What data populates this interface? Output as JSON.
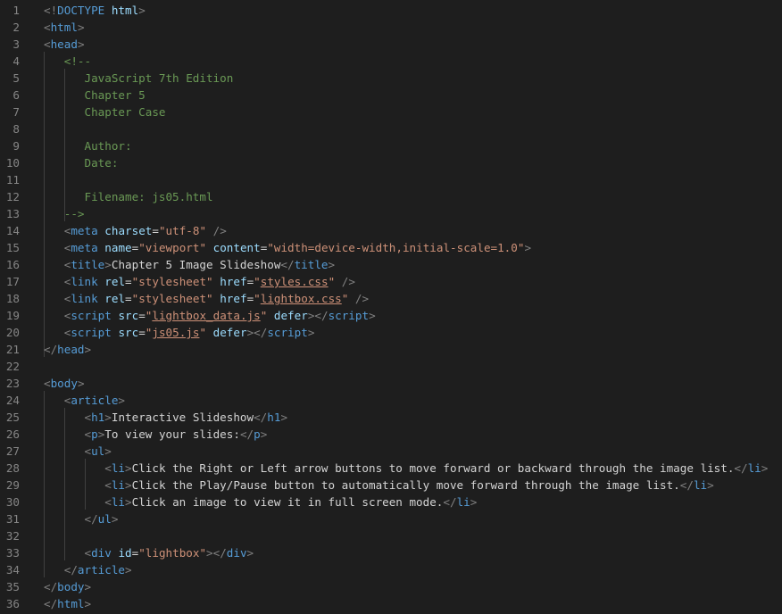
{
  "editor": {
    "lines": [
      [
        {
          "t": "<!",
          "c": "br"
        },
        {
          "t": "DOCTYPE",
          "c": "tag"
        },
        {
          "t": " ",
          "c": "txt"
        },
        {
          "t": "html",
          "c": "attr"
        },
        {
          "t": ">",
          "c": "br"
        }
      ],
      [
        {
          "t": "<",
          "c": "br"
        },
        {
          "t": "html",
          "c": "tag"
        },
        {
          "t": ">",
          "c": "br"
        }
      ],
      [
        {
          "t": "<",
          "c": "br"
        },
        {
          "t": "head",
          "c": "tag"
        },
        {
          "t": ">",
          "c": "br"
        }
      ],
      [
        {
          "t": "   ",
          "c": "txt"
        },
        {
          "t": "<!--",
          "c": "cmt"
        }
      ],
      [
        {
          "t": "      JavaScript 7th Edition",
          "c": "cmt"
        }
      ],
      [
        {
          "t": "      Chapter 5",
          "c": "cmt"
        }
      ],
      [
        {
          "t": "      Chapter Case",
          "c": "cmt"
        }
      ],
      [],
      [
        {
          "t": "      Author:",
          "c": "cmt"
        }
      ],
      [
        {
          "t": "      Date:",
          "c": "cmt"
        }
      ],
      [],
      [
        {
          "t": "      Filename: js05.html",
          "c": "cmt"
        }
      ],
      [
        {
          "t": "   -->",
          "c": "cmt"
        }
      ],
      [
        {
          "t": "   ",
          "c": "txt"
        },
        {
          "t": "<",
          "c": "br"
        },
        {
          "t": "meta",
          "c": "tag"
        },
        {
          "t": " ",
          "c": "txt"
        },
        {
          "t": "charset",
          "c": "attr"
        },
        {
          "t": "=",
          "c": "txt"
        },
        {
          "t": "\"utf-8\"",
          "c": "str"
        },
        {
          "t": " />",
          "c": "br"
        }
      ],
      [
        {
          "t": "   ",
          "c": "txt"
        },
        {
          "t": "<",
          "c": "br"
        },
        {
          "t": "meta",
          "c": "tag"
        },
        {
          "t": " ",
          "c": "txt"
        },
        {
          "t": "name",
          "c": "attr"
        },
        {
          "t": "=",
          "c": "txt"
        },
        {
          "t": "\"viewport\"",
          "c": "str"
        },
        {
          "t": " ",
          "c": "txt"
        },
        {
          "t": "content",
          "c": "attr"
        },
        {
          "t": "=",
          "c": "txt"
        },
        {
          "t": "\"width=device-width,initial-scale=1.0\"",
          "c": "str"
        },
        {
          "t": ">",
          "c": "br"
        }
      ],
      [
        {
          "t": "   ",
          "c": "txt"
        },
        {
          "t": "<",
          "c": "br"
        },
        {
          "t": "title",
          "c": "tag"
        },
        {
          "t": ">",
          "c": "br"
        },
        {
          "t": "Chapter 5 Image Slideshow",
          "c": "txt"
        },
        {
          "t": "</",
          "c": "br"
        },
        {
          "t": "title",
          "c": "tag"
        },
        {
          "t": ">",
          "c": "br"
        }
      ],
      [
        {
          "t": "   ",
          "c": "txt"
        },
        {
          "t": "<",
          "c": "br"
        },
        {
          "t": "link",
          "c": "tag"
        },
        {
          "t": " ",
          "c": "txt"
        },
        {
          "t": "rel",
          "c": "attr"
        },
        {
          "t": "=",
          "c": "txt"
        },
        {
          "t": "\"stylesheet\"",
          "c": "str"
        },
        {
          "t": " ",
          "c": "txt"
        },
        {
          "t": "href",
          "c": "attr"
        },
        {
          "t": "=",
          "c": "txt"
        },
        {
          "t": "\"",
          "c": "str"
        },
        {
          "t": "styles.css",
          "c": "str",
          "u": true
        },
        {
          "t": "\"",
          "c": "str"
        },
        {
          "t": " />",
          "c": "br"
        }
      ],
      [
        {
          "t": "   ",
          "c": "txt"
        },
        {
          "t": "<",
          "c": "br"
        },
        {
          "t": "link",
          "c": "tag"
        },
        {
          "t": " ",
          "c": "txt"
        },
        {
          "t": "rel",
          "c": "attr"
        },
        {
          "t": "=",
          "c": "txt"
        },
        {
          "t": "\"stylesheet\"",
          "c": "str"
        },
        {
          "t": " ",
          "c": "txt"
        },
        {
          "t": "href",
          "c": "attr"
        },
        {
          "t": "=",
          "c": "txt"
        },
        {
          "t": "\"",
          "c": "str"
        },
        {
          "t": "lightbox.css",
          "c": "str",
          "u": true
        },
        {
          "t": "\"",
          "c": "str"
        },
        {
          "t": " />",
          "c": "br"
        }
      ],
      [
        {
          "t": "   ",
          "c": "txt"
        },
        {
          "t": "<",
          "c": "br"
        },
        {
          "t": "script",
          "c": "tag"
        },
        {
          "t": " ",
          "c": "txt"
        },
        {
          "t": "src",
          "c": "attr"
        },
        {
          "t": "=",
          "c": "txt"
        },
        {
          "t": "\"",
          "c": "str"
        },
        {
          "t": "lightbox_data.js",
          "c": "str",
          "u": true
        },
        {
          "t": "\"",
          "c": "str"
        },
        {
          "t": " ",
          "c": "txt"
        },
        {
          "t": "defer",
          "c": "attr"
        },
        {
          "t": "></",
          "c": "br"
        },
        {
          "t": "script",
          "c": "tag"
        },
        {
          "t": ">",
          "c": "br"
        }
      ],
      [
        {
          "t": "   ",
          "c": "txt"
        },
        {
          "t": "<",
          "c": "br"
        },
        {
          "t": "script",
          "c": "tag"
        },
        {
          "t": " ",
          "c": "txt"
        },
        {
          "t": "src",
          "c": "attr"
        },
        {
          "t": "=",
          "c": "txt"
        },
        {
          "t": "\"",
          "c": "str"
        },
        {
          "t": "js05.js",
          "c": "str",
          "u": true
        },
        {
          "t": "\"",
          "c": "str"
        },
        {
          "t": " ",
          "c": "txt"
        },
        {
          "t": "defer",
          "c": "attr"
        },
        {
          "t": "></",
          "c": "br"
        },
        {
          "t": "script",
          "c": "tag"
        },
        {
          "t": ">",
          "c": "br"
        }
      ],
      [
        {
          "t": "</",
          "c": "br"
        },
        {
          "t": "head",
          "c": "tag"
        },
        {
          "t": ">",
          "c": "br"
        }
      ],
      [],
      [
        {
          "t": "<",
          "c": "br"
        },
        {
          "t": "body",
          "c": "tag"
        },
        {
          "t": ">",
          "c": "br"
        }
      ],
      [
        {
          "t": "   ",
          "c": "txt"
        },
        {
          "t": "<",
          "c": "br"
        },
        {
          "t": "article",
          "c": "tag"
        },
        {
          "t": ">",
          "c": "br"
        }
      ],
      [
        {
          "t": "      ",
          "c": "txt"
        },
        {
          "t": "<",
          "c": "br"
        },
        {
          "t": "h1",
          "c": "tag"
        },
        {
          "t": ">",
          "c": "br"
        },
        {
          "t": "Interactive Slideshow",
          "c": "txt"
        },
        {
          "t": "</",
          "c": "br"
        },
        {
          "t": "h1",
          "c": "tag"
        },
        {
          "t": ">",
          "c": "br"
        }
      ],
      [
        {
          "t": "      ",
          "c": "txt"
        },
        {
          "t": "<",
          "c": "br"
        },
        {
          "t": "p",
          "c": "tag"
        },
        {
          "t": ">",
          "c": "br"
        },
        {
          "t": "To view your slides:",
          "c": "txt"
        },
        {
          "t": "</",
          "c": "br"
        },
        {
          "t": "p",
          "c": "tag"
        },
        {
          "t": ">",
          "c": "br"
        }
      ],
      [
        {
          "t": "      ",
          "c": "txt"
        },
        {
          "t": "<",
          "c": "br"
        },
        {
          "t": "ul",
          "c": "tag"
        },
        {
          "t": ">",
          "c": "br"
        }
      ],
      [
        {
          "t": "         ",
          "c": "txt"
        },
        {
          "t": "<",
          "c": "br"
        },
        {
          "t": "li",
          "c": "tag"
        },
        {
          "t": ">",
          "c": "br"
        },
        {
          "t": "Click the Right or Left arrow buttons to move forward or backward through the image list.",
          "c": "txt"
        },
        {
          "t": "</",
          "c": "br"
        },
        {
          "t": "li",
          "c": "tag"
        },
        {
          "t": ">",
          "c": "br"
        }
      ],
      [
        {
          "t": "         ",
          "c": "txt"
        },
        {
          "t": "<",
          "c": "br"
        },
        {
          "t": "li",
          "c": "tag"
        },
        {
          "t": ">",
          "c": "br"
        },
        {
          "t": "Click the Play/Pause button to automatically move forward through the image list.",
          "c": "txt"
        },
        {
          "t": "</",
          "c": "br"
        },
        {
          "t": "li",
          "c": "tag"
        },
        {
          "t": ">",
          "c": "br"
        }
      ],
      [
        {
          "t": "         ",
          "c": "txt"
        },
        {
          "t": "<",
          "c": "br"
        },
        {
          "t": "li",
          "c": "tag"
        },
        {
          "t": ">",
          "c": "br"
        },
        {
          "t": "Click an image to view it in full screen mode.",
          "c": "txt"
        },
        {
          "t": "</",
          "c": "br"
        },
        {
          "t": "li",
          "c": "tag"
        },
        {
          "t": ">",
          "c": "br"
        }
      ],
      [
        {
          "t": "      ",
          "c": "txt"
        },
        {
          "t": "</",
          "c": "br"
        },
        {
          "t": "ul",
          "c": "tag"
        },
        {
          "t": ">",
          "c": "br"
        }
      ],
      [],
      [
        {
          "t": "      ",
          "c": "txt"
        },
        {
          "t": "<",
          "c": "br"
        },
        {
          "t": "div",
          "c": "tag"
        },
        {
          "t": " ",
          "c": "txt"
        },
        {
          "t": "id",
          "c": "attr"
        },
        {
          "t": "=",
          "c": "txt"
        },
        {
          "t": "\"lightbox\"",
          "c": "str"
        },
        {
          "t": "></",
          "c": "br"
        },
        {
          "t": "div",
          "c": "tag"
        },
        {
          "t": ">",
          "c": "br"
        }
      ],
      [
        {
          "t": "   ",
          "c": "txt"
        },
        {
          "t": "</",
          "c": "br"
        },
        {
          "t": "article",
          "c": "tag"
        },
        {
          "t": ">",
          "c": "br"
        }
      ],
      [
        {
          "t": "</",
          "c": "br"
        },
        {
          "t": "body",
          "c": "tag"
        },
        {
          "t": ">",
          "c": "br"
        }
      ],
      [
        {
          "t": "</",
          "c": "br"
        },
        {
          "t": "html",
          "c": "tag"
        },
        {
          "t": ">",
          "c": "br"
        }
      ]
    ]
  }
}
